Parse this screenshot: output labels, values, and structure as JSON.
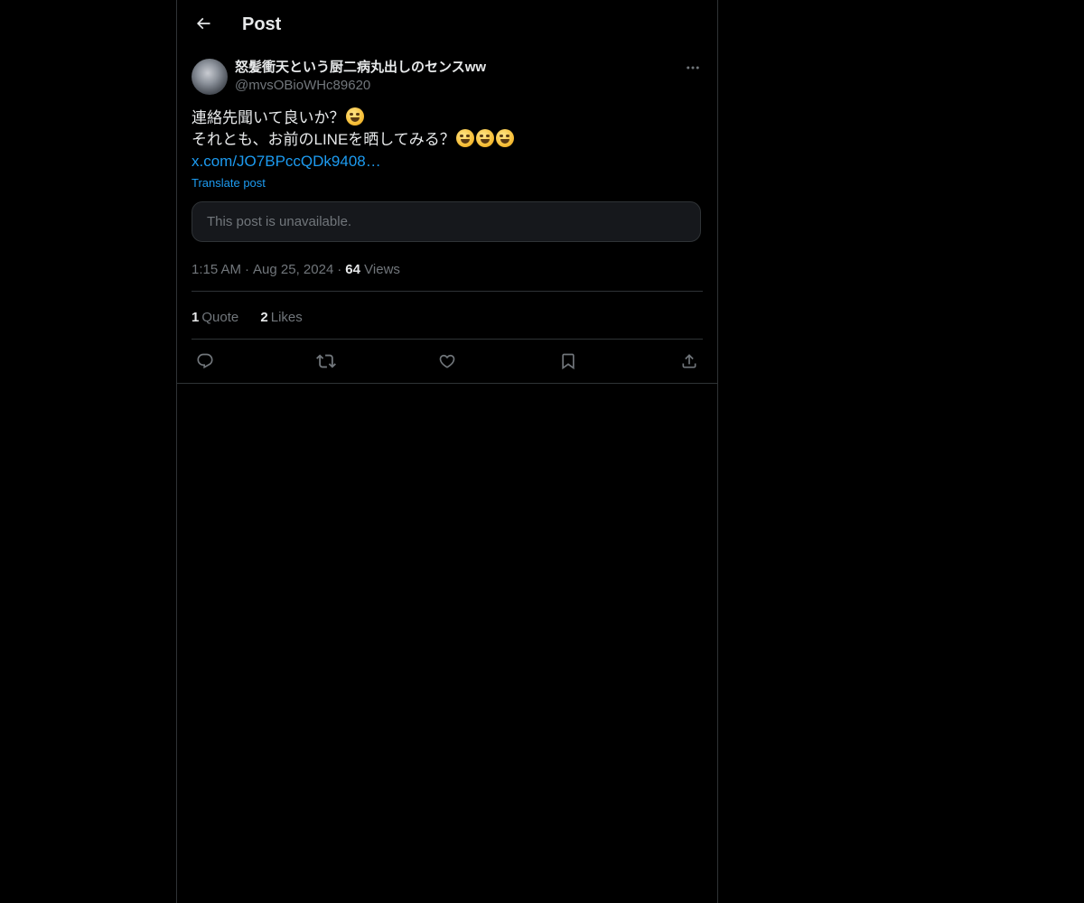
{
  "header": {
    "title": "Post",
    "back_icon": "arrow-left-icon"
  },
  "post": {
    "author": {
      "display_name": "怒髪衝天という厨二病丸出しのセンスww",
      "handle": "@mvsOBioWHc89620"
    },
    "text_line_1": "連絡先聞いて良いか？",
    "text_line_2": "それとも、お前のLINEを晒してみる？",
    "emoji_line_1": [
      "rolling-on-floor-laughing-emoji"
    ],
    "emoji_line_2": [
      "zany-face-emoji",
      "grinning-face-emoji",
      "rolling-on-floor-laughing-emoji"
    ],
    "link": "x.com/JO7BPccQDk9408…",
    "translate_label": "Translate post",
    "quoted_unavailable": "This post is unavailable.",
    "time": "1:15 AM",
    "date": "Aug 25, 2024",
    "separator": "·",
    "views_count": "64",
    "views_label": "Views"
  },
  "stats": {
    "quotes_count": "1",
    "quotes_label": "Quote",
    "likes_count": "2",
    "likes_label": "Likes"
  },
  "actions": [
    {
      "icon": "reply-icon"
    },
    {
      "icon": "repost-icon"
    },
    {
      "icon": "like-icon"
    },
    {
      "icon": "bookmark-icon"
    },
    {
      "icon": "share-icon"
    }
  ],
  "colors": {
    "background": "#000000",
    "text_primary": "#e7e9ea",
    "text_secondary": "#71767b",
    "accent": "#1d9bf0",
    "border": "#2f3336"
  }
}
